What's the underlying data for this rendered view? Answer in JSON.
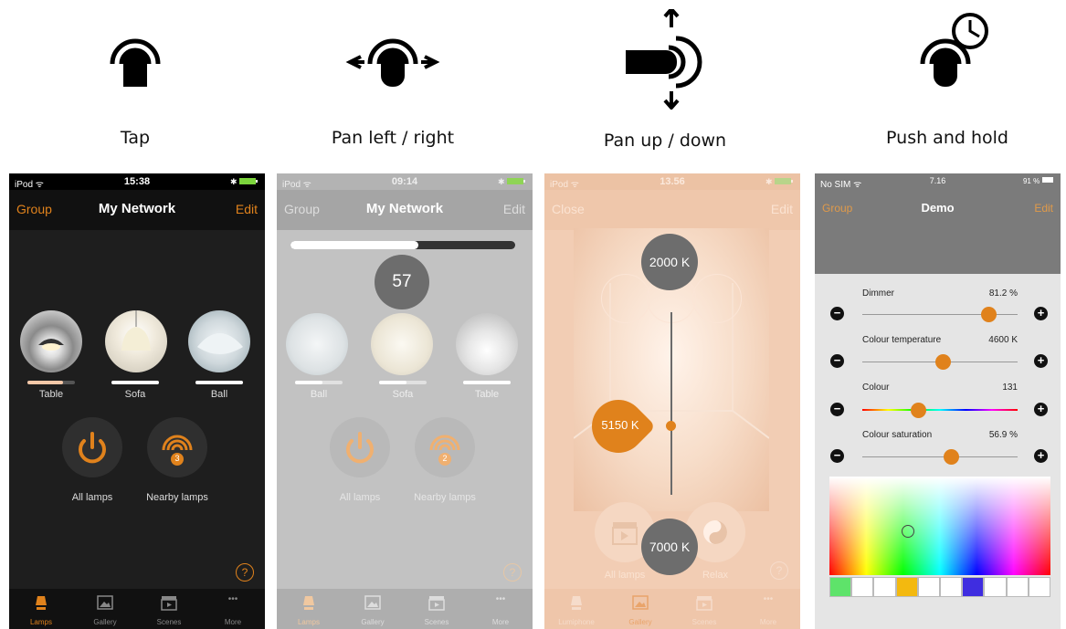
{
  "gestures": {
    "tap": "Tap",
    "pan_lr": "Pan left / right",
    "pan_ud": "Pan up / down",
    "push_hold": "Push and hold"
  },
  "screen1": {
    "status": {
      "carrier": "iPod ᯤ",
      "time": "15:38"
    },
    "nav": {
      "left": "Group",
      "title": "My Network",
      "right": "Edit"
    },
    "lamps": [
      {
        "label": "Table",
        "level": 0.75
      },
      {
        "label": "Sofa",
        "level": 1.0
      },
      {
        "label": "Ball",
        "level": 1.0
      }
    ],
    "buttons": {
      "all": "All lamps",
      "nearby": "Nearby lamps",
      "nearby_count": "3"
    },
    "help": "?",
    "tabs": [
      "Lamps",
      "Gallery",
      "Scenes",
      "More"
    ],
    "more_glyph": "•••"
  },
  "screen2": {
    "status": {
      "carrier": "iPod ᯤ",
      "time": "09:14"
    },
    "nav": {
      "left": "Group",
      "title": "My Network",
      "right": "Edit"
    },
    "progress": 0.57,
    "value_bubble": "57",
    "lamps": [
      {
        "label": "Ball",
        "level": 0.57
      },
      {
        "label": "Sofa",
        "level": 0.57
      },
      {
        "label": "Table",
        "level": 1.0
      }
    ],
    "buttons": {
      "all": "All lamps",
      "nearby": "Nearby lamps",
      "nearby_count": "2"
    },
    "help": "?",
    "tabs": [
      "Lamps",
      "Gallery",
      "Scenes",
      "More"
    ],
    "more_glyph": "•••"
  },
  "screen3": {
    "status": {
      "carrier": "iPod ᯤ",
      "time": "13.56"
    },
    "nav": {
      "left": "Close",
      "right": "Edit"
    },
    "top_value": "2000 K",
    "current_value": "5150 K",
    "bottom_value": "7000 K",
    "buttons": {
      "all": "All lamps",
      "relax": "Relax"
    },
    "help": "?",
    "tabs": [
      "Lumiphone",
      "Gallery",
      "Scenes",
      "More"
    ],
    "more_glyph": "•••"
  },
  "screen4": {
    "status": {
      "carrier": "No SIM ᯤ",
      "time": "7.16",
      "battery": "91 %"
    },
    "nav": {
      "left": "Group",
      "title": "Demo",
      "right": "Edit"
    },
    "sliders": [
      {
        "label": "Dimmer",
        "value": "81.2 %",
        "position": 0.812
      },
      {
        "label": "Colour temperature",
        "value": "4600 K",
        "position": 0.52
      },
      {
        "label": "Colour",
        "value": "131",
        "position": 0.36
      },
      {
        "label": "Colour saturation",
        "value": "56.9 %",
        "position": 0.569
      }
    ],
    "swatches": [
      "#5ee36a",
      "#ffffff",
      "#ffffff",
      "#f3b90f",
      "#ffffff",
      "#ffffff",
      "#3f2de0",
      "#ffffff",
      "#ffffff",
      "#ffffff"
    ]
  },
  "colors": {
    "accent": "#e0821c",
    "dark_bg": "#1e1e1e",
    "nav_dark": "#111111",
    "grey_bg": "#c2c2c2",
    "peach_bg": "#f2cdb4"
  }
}
